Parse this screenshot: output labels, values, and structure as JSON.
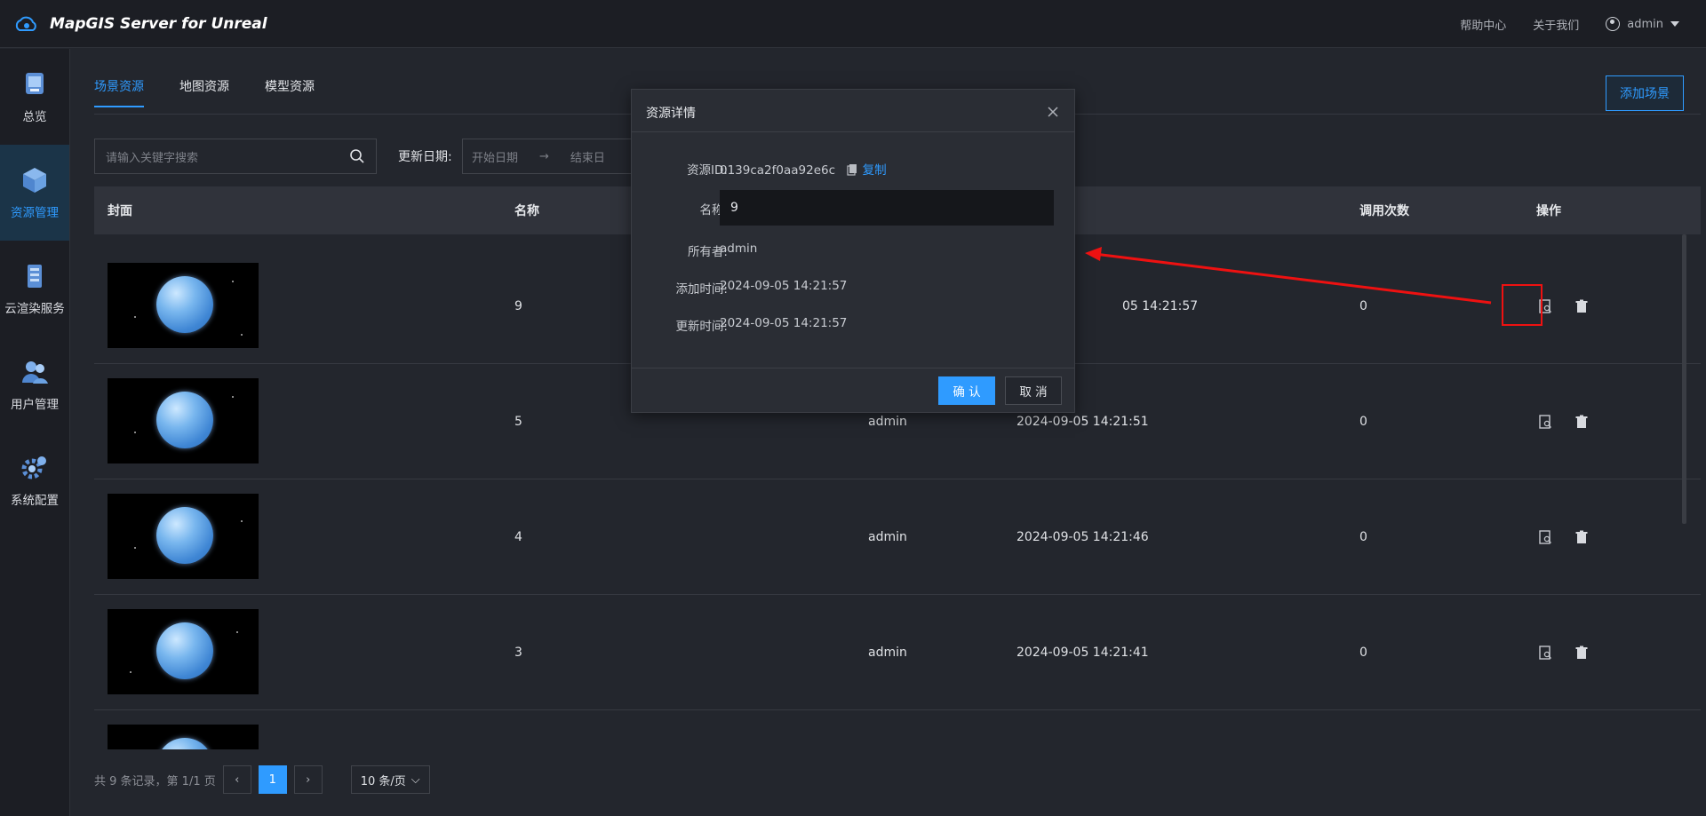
{
  "header": {
    "title": "MapGIS Server for Unreal",
    "help": "帮助中心",
    "about": "关于我们",
    "user": "admin"
  },
  "sidebar": {
    "items": [
      {
        "label": "总览",
        "icon": "overview-icon"
      },
      {
        "label": "资源管理",
        "icon": "resource-icon",
        "active": true
      },
      {
        "label": "云渲染服务",
        "icon": "cloud-render-icon"
      },
      {
        "label": "用户管理",
        "icon": "users-icon"
      },
      {
        "label": "系统配置",
        "icon": "settings-icon"
      }
    ]
  },
  "tabs": [
    "场景资源",
    "地图资源",
    "模型资源"
  ],
  "toolbar": {
    "add_label": "添加场景",
    "search_placeholder": "请输入关键字搜索",
    "date_label": "更新日期:",
    "start_placeholder": "开始日期",
    "end_placeholder": "结束日"
  },
  "table": {
    "columns": {
      "cover": "封面",
      "name": "名称",
      "calls": "调用次数",
      "ops": "操作"
    },
    "rows": [
      {
        "name": "9",
        "owner": "",
        "time": "05 14:21:57",
        "calls": "0"
      },
      {
        "name": "5",
        "owner": "admin",
        "time": "2024-09-05 14:21:51",
        "calls": "0"
      },
      {
        "name": "4",
        "owner": "admin",
        "time": "2024-09-05 14:21:46",
        "calls": "0"
      },
      {
        "name": "3",
        "owner": "admin",
        "time": "2024-09-05 14:21:41",
        "calls": "0"
      }
    ]
  },
  "pagination": {
    "summary": "共 9 条记录，第 1/1 页",
    "current": "1",
    "page_size": "10 条/页"
  },
  "dialog": {
    "title": "资源详情",
    "id_label": "资源ID:",
    "id_value": "0139ca2f0aa92e6c",
    "copy": "复制",
    "name_label": "名称:",
    "name_value": "9",
    "owner_label": "所有者:",
    "owner_value": "admin",
    "added_label": "添加时间:",
    "added_value": "2024-09-05 14:21:57",
    "updated_label": "更新时间:",
    "updated_value": "2024-09-05 14:21:57",
    "ok": "确 认",
    "cancel": "取 消"
  },
  "colors": {
    "accent": "#2f9bff",
    "highlight": "#e11111"
  }
}
